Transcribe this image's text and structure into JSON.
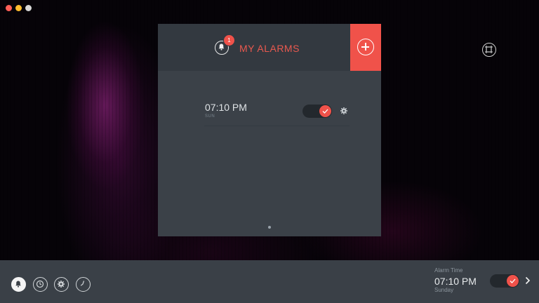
{
  "window": {
    "controls": [
      "close",
      "minimize",
      "zoom"
    ]
  },
  "panel": {
    "title": "MY ALARMS",
    "notification_count": "1",
    "add_icon": "plus-circle-icon",
    "alarms": [
      {
        "time": "07:10 PM",
        "day": "SUN",
        "enabled": true
      }
    ],
    "page_indicator": {
      "pages": 1,
      "current": 1
    }
  },
  "desktop": {
    "fullscreen_icon": "fullscreen-icon"
  },
  "bottom_bar": {
    "nav": [
      {
        "name": "alarms",
        "icon": "bell-icon",
        "active": true
      },
      {
        "name": "timer",
        "icon": "clock-icon",
        "active": false
      },
      {
        "name": "settings",
        "icon": "gear-icon",
        "active": false
      },
      {
        "name": "stopwatch",
        "icon": "watch-hand-icon",
        "active": false
      }
    ],
    "alarm_label": "Alarm Time",
    "alarm_time": "07:10 PM",
    "alarm_day": "Sunday",
    "alarm_enabled": true
  },
  "colors": {
    "accent": "#f0524a",
    "panel_bg": "#3b4148",
    "header_bg": "#333940",
    "bar_bg": "#3a4047"
  }
}
